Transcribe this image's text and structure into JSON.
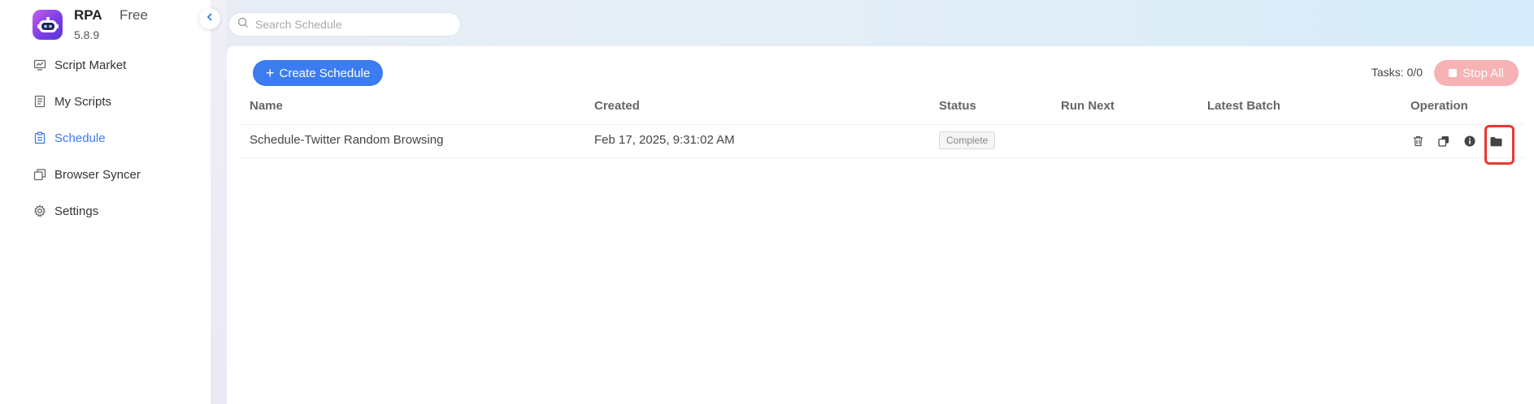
{
  "app": {
    "name": "RPA",
    "plan": "Free",
    "version": "5.8.9"
  },
  "sidebar": {
    "items": [
      {
        "label": "Script Market",
        "icon": "monitor-icon",
        "active": false
      },
      {
        "label": "My Scripts",
        "icon": "document-icon",
        "active": false
      },
      {
        "label": "Schedule",
        "icon": "clipboard-icon",
        "active": true
      },
      {
        "label": "Browser Syncer",
        "icon": "windows-icon",
        "active": false
      },
      {
        "label": "Settings",
        "icon": "gear-icon",
        "active": false
      }
    ]
  },
  "search": {
    "placeholder": "Search Schedule",
    "value": ""
  },
  "toolbar": {
    "create_label": "Create Schedule",
    "tasks_label": "Tasks: 0/0",
    "stop_all_label": "Stop All"
  },
  "table": {
    "columns": [
      "Name",
      "Created",
      "Status",
      "Run Next",
      "Latest Batch",
      "Operation"
    ],
    "rows": [
      {
        "name": "Schedule-Twitter Random Browsing",
        "created": "Feb 17, 2025, 9:31:02 AM",
        "status": "Complete",
        "run_next": "",
        "latest_batch": "",
        "operations": [
          "trash-icon",
          "copy-icon",
          "info-icon",
          "folder-icon"
        ]
      }
    ]
  },
  "colors": {
    "accent": "#3b7cf0",
    "active_nav": "#3a7bec",
    "stop_button": "#f6b2b4",
    "highlight_box": "#e8392d"
  }
}
